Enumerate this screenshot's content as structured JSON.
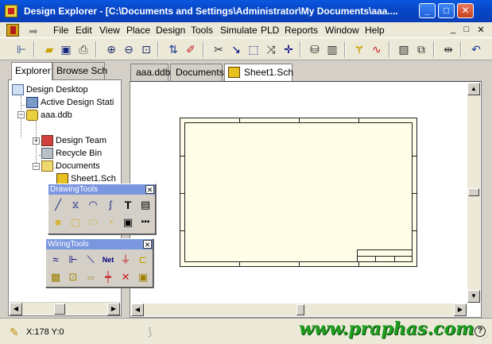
{
  "window": {
    "title": "Design Explorer - [C:\\Documents and Settings\\Administrator\\My Documents\\aaa....",
    "minimize": "_",
    "maximize": "□",
    "close": "✕"
  },
  "menu": {
    "items": [
      "File",
      "Edit",
      "View",
      "Place",
      "Design",
      "Tools",
      "Simulate",
      "PLD",
      "Reports",
      "Window",
      "Help"
    ],
    "mdi": [
      "_",
      "□",
      "✕"
    ]
  },
  "explorer": {
    "tabs": [
      "Explorer",
      "Browse Sch"
    ],
    "tree": [
      {
        "label": "Design Desktop"
      },
      {
        "label": "Active Design Stati"
      },
      {
        "label": "aaa.ddb"
      },
      {
        "label": "Design Team"
      },
      {
        "label": "Recycle Bin"
      },
      {
        "label": "Documents"
      },
      {
        "label": "Sheet1.Sch"
      }
    ]
  },
  "documents": {
    "tabs": [
      "aaa.ddb",
      "Documents",
      "Sheet1.Sch"
    ]
  },
  "palettes": {
    "drawing": {
      "title": "DrawingTools",
      "close": "✕"
    },
    "wiring": {
      "title": "WiringTools",
      "close": "✕"
    }
  },
  "status": {
    "coords": "X:178 Y:0",
    "help": "?",
    "watermark": "www.praphas.com"
  },
  "colors": {
    "titlebar": "#0747c8",
    "sheet_background": "#fffde8",
    "watermark": "#1e9e1e"
  }
}
